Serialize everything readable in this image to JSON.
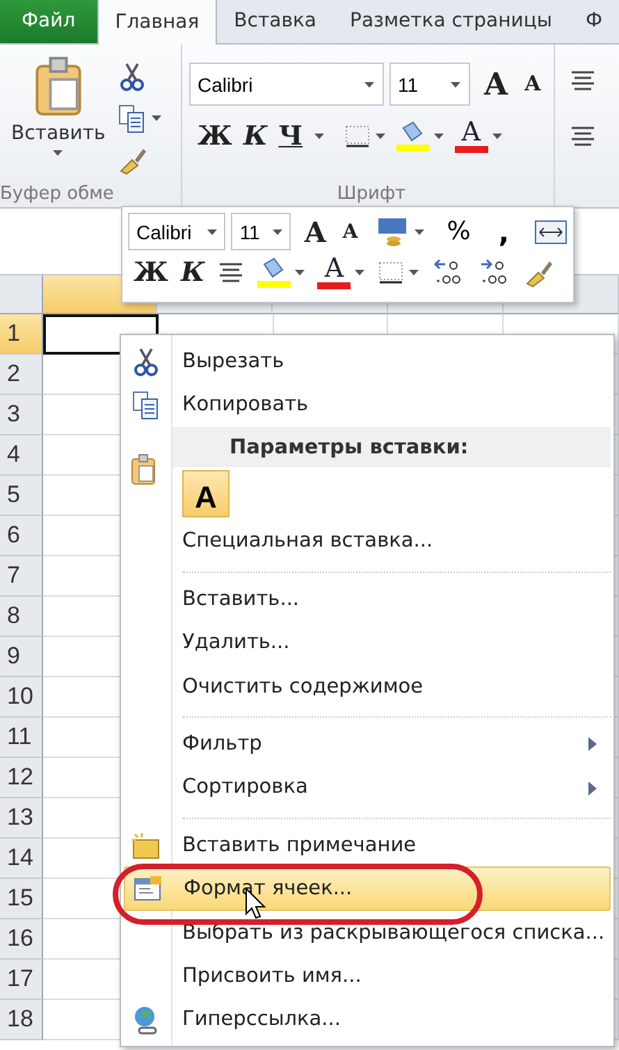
{
  "tabs": [
    {
      "label": "Файл",
      "kind": "file",
      "selected": false
    },
    {
      "label": "Главная",
      "kind": "tab",
      "selected": true
    },
    {
      "label": "Вставка",
      "kind": "tab",
      "selected": false
    },
    {
      "label": "Разметка страницы",
      "kind": "tab",
      "selected": false
    },
    {
      "label": "Ф",
      "kind": "tab",
      "selected": false
    }
  ],
  "ribbon": {
    "clipboard": {
      "paste_label": "Вставить",
      "group_label": "Буфер обме"
    },
    "font": {
      "name": "Calibri",
      "size": "11",
      "grow": "A",
      "shrink": "A",
      "bold": "Ж",
      "italic": "К",
      "underline": "Ч",
      "font_color_letter": "A",
      "group_label": "Шрифт"
    }
  },
  "mini_toolbar": {
    "font": "Calibri",
    "size": "11",
    "grow": "A",
    "shrink": "A",
    "percent": "%",
    "comma": ",",
    "bold": "Ж",
    "italic": "К",
    "font_color_letter": "A"
  },
  "sheet": {
    "columns": [
      {
        "selected": true
      },
      {
        "selected": false
      },
      {
        "selected": false
      },
      {
        "selected": false
      },
      {
        "selected": false
      }
    ],
    "rows": [
      {
        "label": "1",
        "selected": true
      },
      {
        "label": "2",
        "selected": false
      },
      {
        "label": "3",
        "selected": false
      },
      {
        "label": "4",
        "selected": false
      },
      {
        "label": "5",
        "selected": false
      },
      {
        "label": "6",
        "selected": false
      },
      {
        "label": "7",
        "selected": false
      },
      {
        "label": "8",
        "selected": false
      },
      {
        "label": "9",
        "selected": false
      },
      {
        "label": "10",
        "selected": false
      },
      {
        "label": "11",
        "selected": false
      },
      {
        "label": "12",
        "selected": false
      },
      {
        "label": "13",
        "selected": false
      },
      {
        "label": "14",
        "selected": false
      },
      {
        "label": "15",
        "selected": false
      },
      {
        "label": "16",
        "selected": false
      },
      {
        "label": "17",
        "selected": false
      },
      {
        "label": "18",
        "selected": false
      }
    ]
  },
  "context_menu": [
    {
      "kind": "scissors",
      "label": "Вырезать",
      "highlighted": false,
      "submenu": false
    },
    {
      "kind": "pages",
      "label": "Копировать",
      "highlighted": false,
      "submenu": false
    },
    {
      "kind": "header",
      "label": "Параметры вставки:"
    },
    {
      "kind": "paste_option",
      "label": "A"
    },
    {
      "kind": "plain",
      "label": "Специальная вставка...",
      "highlighted": false,
      "submenu": false
    },
    {
      "kind": "separator"
    },
    {
      "kind": "plain",
      "label": "Вставить...",
      "highlighted": false,
      "submenu": false
    },
    {
      "kind": "plain",
      "label": "Удалить...",
      "highlighted": false,
      "submenu": false
    },
    {
      "kind": "plain",
      "label": "Очистить содержимое",
      "highlighted": false,
      "submenu": false
    },
    {
      "kind": "separator"
    },
    {
      "kind": "plain",
      "label": "Фильтр",
      "highlighted": false,
      "submenu": true
    },
    {
      "kind": "plain",
      "label": "Сортировка",
      "highlighted": false,
      "submenu": true
    },
    {
      "kind": "separator"
    },
    {
      "kind": "note",
      "label": "Вставить примечание",
      "highlighted": false,
      "submenu": false
    },
    {
      "kind": "form",
      "label": "Формат ячеек...",
      "highlighted": true,
      "submenu": false,
      "circled": true
    },
    {
      "kind": "plain",
      "label": "Выбрать из раскрывающегося списка...",
      "highlighted": false,
      "submenu": false
    },
    {
      "kind": "plain",
      "label": "Присвоить имя...",
      "highlighted": false,
      "submenu": false
    },
    {
      "kind": "globe",
      "label": "Гиперссылка...",
      "highlighted": false,
      "submenu": false
    }
  ]
}
